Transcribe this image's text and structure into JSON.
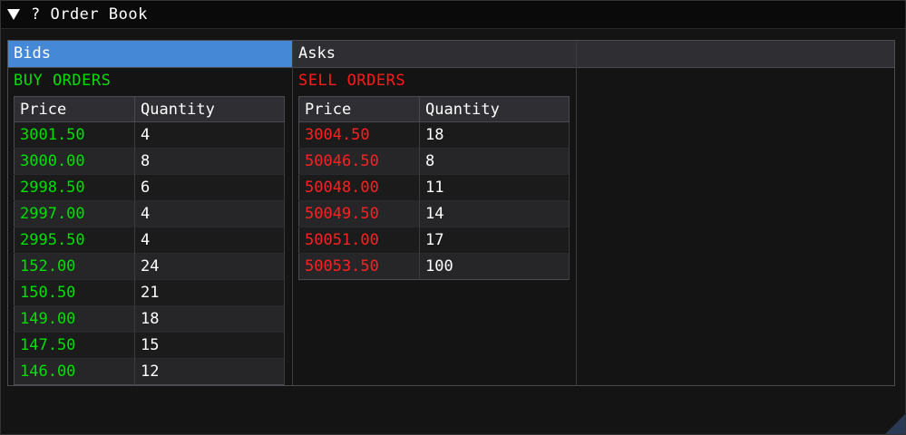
{
  "window": {
    "title": "? Order Book"
  },
  "tabs": [
    {
      "label": "Bids",
      "active": true
    },
    {
      "label": "Asks",
      "active": false
    },
    {
      "label": "",
      "active": false
    }
  ],
  "bids": {
    "section_label": "BUY ORDERS",
    "columns": [
      "Price",
      "Quantity"
    ],
    "rows": [
      {
        "price": "3001.50",
        "quantity": "4"
      },
      {
        "price": "3000.00",
        "quantity": "8"
      },
      {
        "price": "2998.50",
        "quantity": "6"
      },
      {
        "price": "2997.00",
        "quantity": "4"
      },
      {
        "price": "2995.50",
        "quantity": "4"
      },
      {
        "price": "152.00",
        "quantity": "24"
      },
      {
        "price": "150.50",
        "quantity": "21"
      },
      {
        "price": "149.00",
        "quantity": "18"
      },
      {
        "price": "147.50",
        "quantity": "15"
      },
      {
        "price": "146.00",
        "quantity": "12"
      }
    ]
  },
  "asks": {
    "section_label": "SELL ORDERS",
    "columns": [
      "Price",
      "Quantity"
    ],
    "rows": [
      {
        "price": "3004.50",
        "quantity": "18"
      },
      {
        "price": "50046.50",
        "quantity": "8"
      },
      {
        "price": "50048.00",
        "quantity": "11"
      },
      {
        "price": "50049.50",
        "quantity": "14"
      },
      {
        "price": "50051.00",
        "quantity": "17"
      },
      {
        "price": "50053.50",
        "quantity": "100"
      }
    ]
  },
  "colors": {
    "buy": "#00e000",
    "sell": "#ff2020",
    "active_header": "#4589d6"
  },
  "icons": {
    "collapse": "collapse-triangle-icon",
    "resize": "resize-grip-icon"
  }
}
